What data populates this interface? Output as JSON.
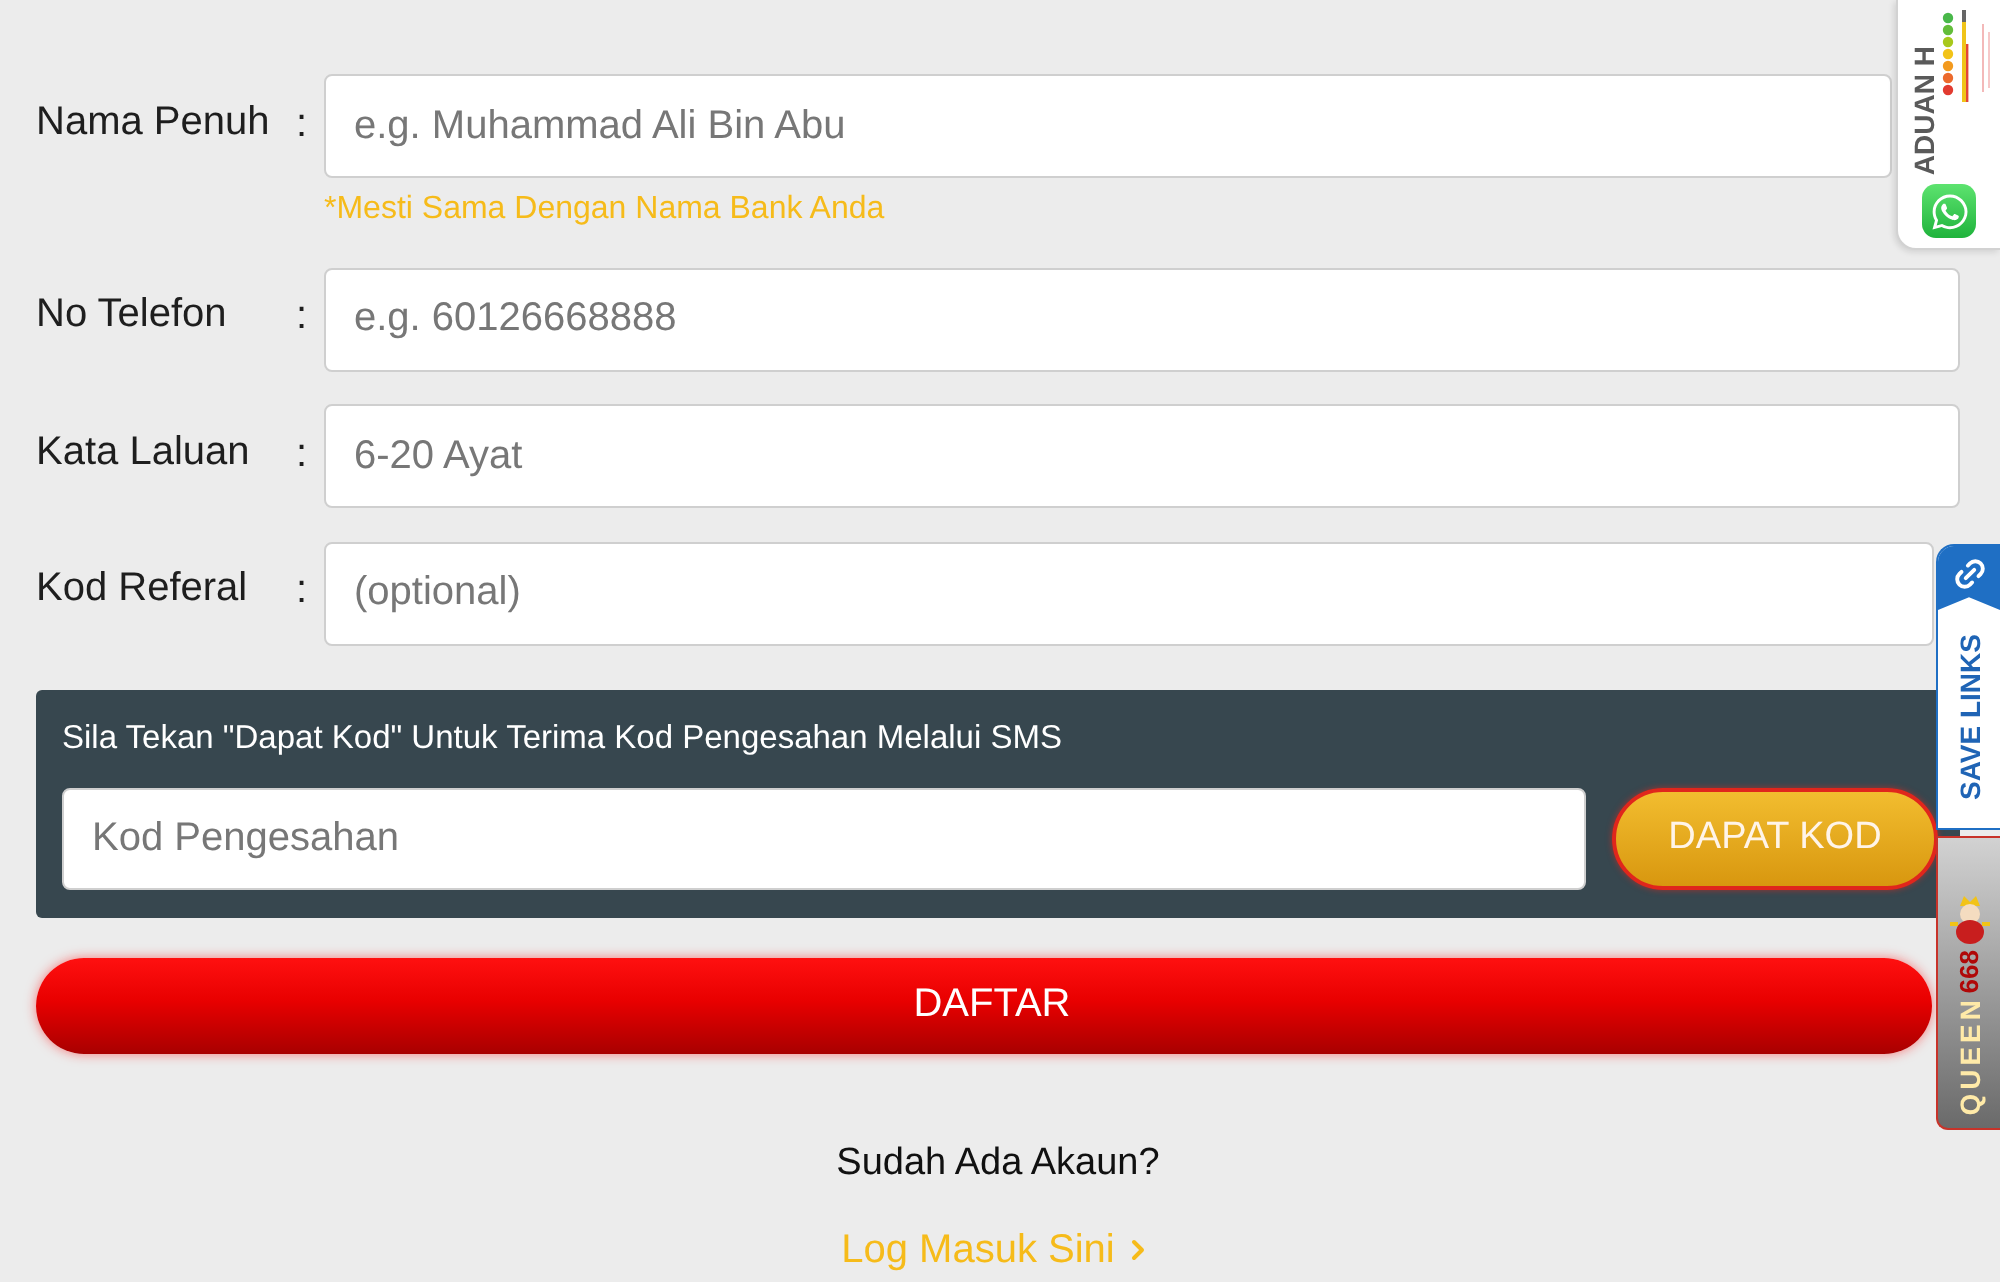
{
  "form": {
    "fields": [
      {
        "label": "Nama Penuh",
        "separator": ":",
        "placeholder": "e.g. Muhammad Ali Bin Abu",
        "hint": "*Mesti Sama Dengan Nama Bank Anda"
      },
      {
        "label": "No Telefon",
        "separator": ":",
        "placeholder": "e.g. 60126668888"
      },
      {
        "label": "Kata Laluan",
        "separator": ":",
        "placeholder": "6-20 Ayat"
      },
      {
        "label": "Kod Referal",
        "separator": ":",
        "placeholder": "(optional)"
      }
    ]
  },
  "verification": {
    "instruction": "Sila Tekan \"Dapat Kod\" Untuk Terima Kod Pengesahan Melalui SMS",
    "placeholder": "Kod Pengesahan",
    "button": "DAPAT KOD"
  },
  "submit_button": "DAFTAR",
  "login_prompt": {
    "question": "Sudah Ada Akaun?",
    "link": "Log Masuk Sini"
  },
  "side_widgets": [
    {
      "kind": "complaint",
      "label": "ADUAN H"
    },
    {
      "kind": "save_links",
      "label": "SAVE LINKS"
    },
    {
      "kind": "brand",
      "name": "QUEEN",
      "number": "668"
    }
  ]
}
